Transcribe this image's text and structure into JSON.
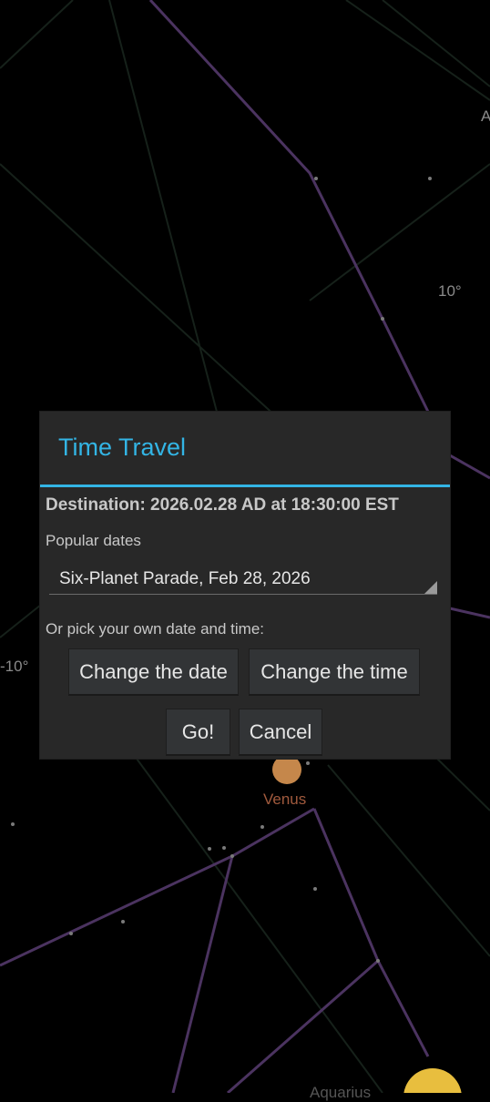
{
  "sky": {
    "label_top_right_partial": "A",
    "grid_label_right": "10°",
    "grid_label_left": "-10°",
    "planet_label_venus": "Venus",
    "planet_label_bottom_partial": "Aquarius",
    "colors": {
      "background": "#000000",
      "constellation_line": "#5a3c6e",
      "grid_line": "#1e2a22",
      "venus": "#c98a4b",
      "jupiter": "#f0c64a"
    }
  },
  "dialog": {
    "title": "Time Travel",
    "destination": "Destination: 2026.02.28 AD at 18:30:00 EST",
    "popular_label": "Popular dates",
    "popular_selected": "Six-Planet Parade, Feb 28, 2026",
    "pick_label": "Or pick your own date and time:",
    "change_date_label": "Change the date",
    "change_time_label": "Change the time",
    "go_label": "Go!",
    "cancel_label": "Cancel",
    "accent_color": "#33b5e5"
  }
}
